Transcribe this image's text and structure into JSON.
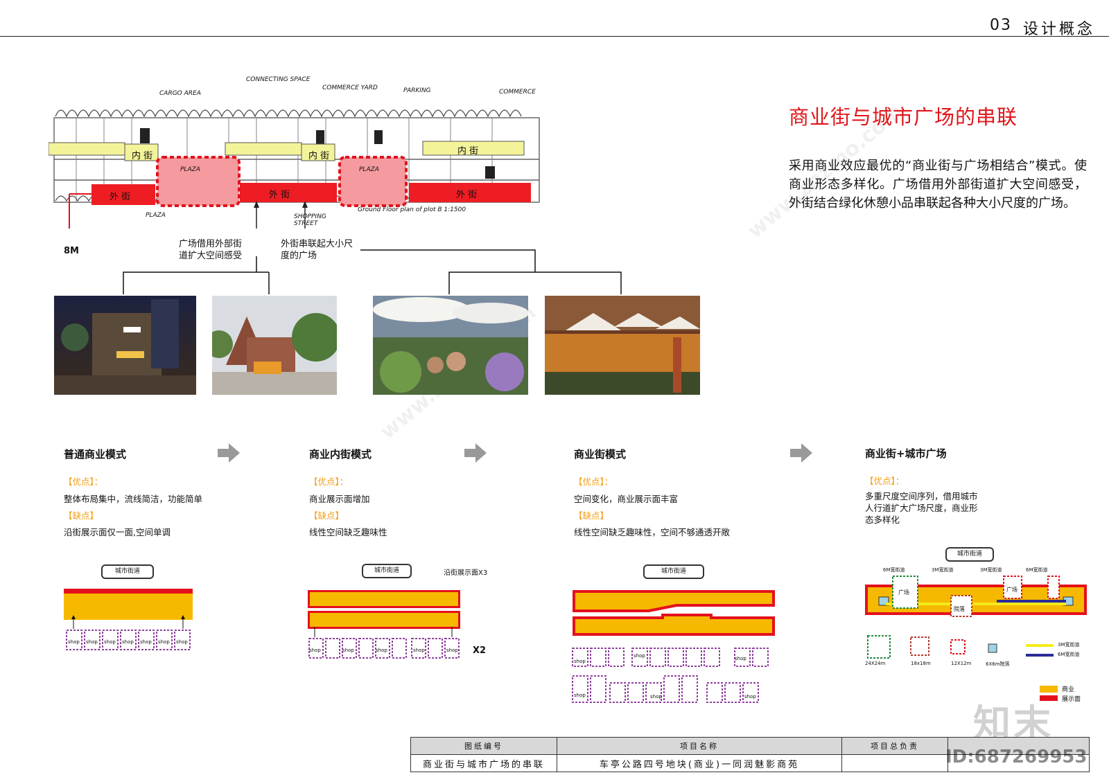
{
  "header": {
    "page_number": "03",
    "section_title": "设计概念"
  },
  "title": "商业街与城市广场的串联",
  "intro": "采用商业效应最优的“商业街与广场相结合”模式。使商业形态多样化。广场借用外部街道扩大空间感受，外街结合绿化休憩小品串联起各种大小尺度的广场。",
  "sketch": {
    "annotations": [
      "CONNECTING SPACE",
      "COMMERCE YARD",
      "CARGO AREA",
      "PARKING",
      "COMMERCE",
      "PLAZA",
      "SHOPPING STREET",
      "Ground Floor plan of plot B 1:1500"
    ],
    "inner_street": "内 街",
    "outer_street": "外 街",
    "plaza": "PLAZA"
  },
  "callouts": {
    "width": "8M",
    "left": "广场借用外部街道扩大空间感受",
    "right": "外街串联起大小尺度的广场"
  },
  "modes": [
    {
      "title": "普通商业模式",
      "pros_label": "【优点】：",
      "pros": "整体布局集中，流线简洁，功能简单",
      "cons_label": "【缺点】",
      "cons": "沿街展示面仅一面,空间单调"
    },
    {
      "title": "商业内街模式",
      "pros_label": "【优点】：",
      "pros": "商业展示面增加",
      "cons_label": "【缺点】",
      "cons": "线性空间缺乏趣味性"
    },
    {
      "title": "商业街模式",
      "pros_label": "【优点】：",
      "pros": "空间变化，商业展示面丰富",
      "cons_label": "【缺点】",
      "cons": "线性空间缺乏趣味性，空间不够通透开敞"
    },
    {
      "title": "商业街+城市广场",
      "pros_label": "【优点】：",
      "pros": "多重尺度空间序列，借用城市人行道扩大广场尺度，商业形态多样化"
    }
  ],
  "diagram": {
    "city_street": "城市街道",
    "shop": "shop",
    "display_x3": "沿街展示面X3",
    "x2": "X2",
    "square": "广场",
    "courtyard": "院落",
    "street_labels": [
      "6M宽街道",
      "3M宽街道",
      "3M宽街道",
      "6M宽街道"
    ],
    "sizes": [
      "24X24m",
      "18x18m",
      "12X12m",
      "6X6m院落"
    ],
    "line_legend": [
      "3M宽街道",
      "6M宽街道"
    ],
    "legend": [
      "商业",
      "展示面"
    ]
  },
  "colors": {
    "accent": "#e0161b",
    "commerce": "#f7b900",
    "display": "#e3111c",
    "shop": "#8e3f9e",
    "plaza_green": "#1f8a3b"
  },
  "title_block": {
    "headers": [
      "图纸编号",
      "项目名称",
      "项目总负责"
    ],
    "values": [
      "商业街与城市广场的串联",
      "车亭公路四号地块(商业)一同润魅影商苑"
    ]
  },
  "watermark": {
    "id": "ID:687269953",
    "brand": "知末",
    "site": "www.znzmo.com"
  }
}
